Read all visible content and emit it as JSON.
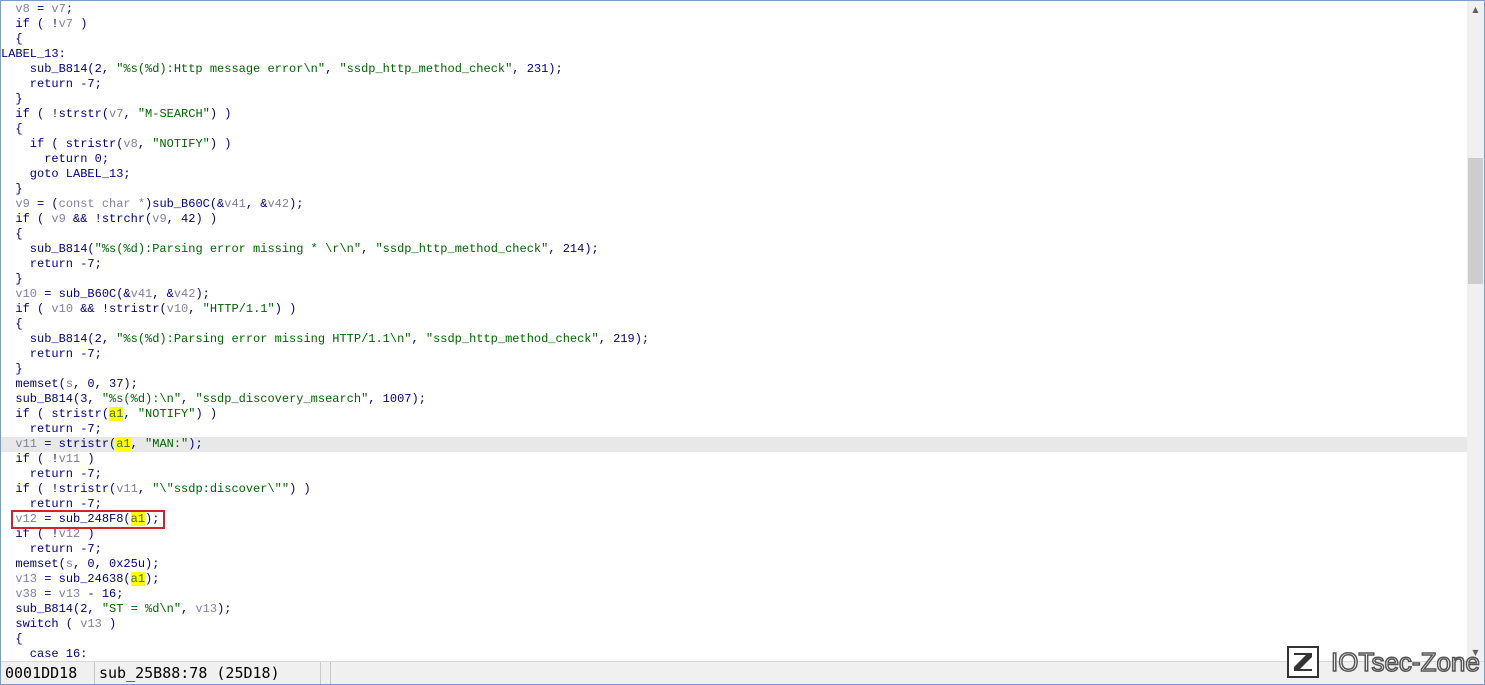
{
  "code_lines": [
    [
      [
        "  ",
        ""
      ],
      [
        "v8",
        "v"
      ],
      [
        " = ",
        ""
      ],
      [
        "v7",
        "v"
      ],
      [
        ";",
        ""
      ]
    ],
    [
      [
        "  if ( !",
        ""
      ],
      [
        "v7",
        "v"
      ],
      [
        " )",
        ""
      ]
    ],
    [
      [
        "  {",
        ""
      ]
    ],
    [
      [
        "LABEL_13:",
        ""
      ]
    ],
    [
      [
        "    sub_B814(2, ",
        ""
      ],
      [
        "\"%s(%d):Http message error\\n\"",
        "s"
      ],
      [
        ", ",
        ""
      ],
      [
        "\"ssdp_http_method_check\"",
        "s"
      ],
      [
        ", 231);",
        ""
      ]
    ],
    [
      [
        "    return -7;",
        ""
      ]
    ],
    [
      [
        "  }",
        ""
      ]
    ],
    [
      [
        "  if ( !strstr(",
        ""
      ],
      [
        "v7",
        "v"
      ],
      [
        ", ",
        ""
      ],
      [
        "\"M-SEARCH\"",
        "s"
      ],
      [
        ") )",
        ""
      ]
    ],
    [
      [
        "  {",
        ""
      ]
    ],
    [
      [
        "    if ( stristr(",
        ""
      ],
      [
        "v8",
        "v"
      ],
      [
        ", ",
        ""
      ],
      [
        "\"NOTIFY\"",
        "s"
      ],
      [
        ") )",
        ""
      ]
    ],
    [
      [
        "      return 0;",
        ""
      ]
    ],
    [
      [
        "    goto LABEL_13;",
        ""
      ]
    ],
    [
      [
        "  }",
        ""
      ]
    ],
    [
      [
        "  ",
        ""
      ],
      [
        "v9",
        "v"
      ],
      [
        " = (",
        ""
      ],
      [
        "const char *",
        "v"
      ],
      [
        ")sub_B60C(&",
        ""
      ],
      [
        "v41",
        "v"
      ],
      [
        ", &",
        ""
      ],
      [
        "v42",
        "v"
      ],
      [
        ");",
        ""
      ]
    ],
    [
      [
        "  if ( ",
        ""
      ],
      [
        "v9",
        "v"
      ],
      [
        " && !strchr(",
        ""
      ],
      [
        "v9",
        "v"
      ],
      [
        ", 42) )",
        ""
      ]
    ],
    [
      [
        "  {",
        ""
      ]
    ],
    [
      [
        "    sub_B814(",
        ""
      ],
      [
        "\"%s(%d):Parsing error missing * \\r\\n\"",
        "s"
      ],
      [
        ", ",
        ""
      ],
      [
        "\"ssdp_http_method_check\"",
        "s"
      ],
      [
        ", 214);",
        ""
      ]
    ],
    [
      [
        "    return -7;",
        ""
      ]
    ],
    [
      [
        "  }",
        ""
      ]
    ],
    [
      [
        "  ",
        ""
      ],
      [
        "v10",
        "v"
      ],
      [
        " = sub_B60C(&",
        ""
      ],
      [
        "v41",
        "v"
      ],
      [
        ", &",
        ""
      ],
      [
        "v42",
        "v"
      ],
      [
        ");",
        ""
      ]
    ],
    [
      [
        "  if ( ",
        ""
      ],
      [
        "v10",
        "v"
      ],
      [
        " && !stristr(",
        ""
      ],
      [
        "v10",
        "v"
      ],
      [
        ", ",
        ""
      ],
      [
        "\"HTTP/1.1\"",
        "s"
      ],
      [
        ") )",
        ""
      ]
    ],
    [
      [
        "  {",
        ""
      ]
    ],
    [
      [
        "    sub_B814(2, ",
        ""
      ],
      [
        "\"%s(%d):Parsing error missing HTTP/1.1\\n\"",
        "s"
      ],
      [
        ", ",
        ""
      ],
      [
        "\"ssdp_http_method_check\"",
        "s"
      ],
      [
        ", 219);",
        ""
      ]
    ],
    [
      [
        "    return -7;",
        ""
      ]
    ],
    [
      [
        "  }",
        ""
      ]
    ],
    [
      [
        "  memset(",
        ""
      ],
      [
        "s",
        "v"
      ],
      [
        ", 0, 37);",
        ""
      ]
    ],
    [
      [
        "  sub_B814(3, ",
        ""
      ],
      [
        "\"%s(%d):\\n\"",
        "s"
      ],
      [
        ", ",
        ""
      ],
      [
        "\"ssdp_discovery_msearch\"",
        "s"
      ],
      [
        ", 1007);",
        ""
      ]
    ],
    [
      [
        "  if ( stristr(",
        ""
      ],
      [
        "a1",
        "hl"
      ],
      [
        ", ",
        ""
      ],
      [
        "\"NOTIFY\"",
        "s"
      ],
      [
        ") )",
        ""
      ]
    ],
    [
      [
        "    return -7;",
        ""
      ]
    ],
    [
      [
        "  ",
        ""
      ],
      [
        "v11",
        "v"
      ],
      [
        " = stristr(",
        ""
      ],
      [
        "|",
        "caret"
      ],
      [
        "a1",
        "hl"
      ],
      [
        ", ",
        ""
      ],
      [
        "\"MAN:\"",
        "s"
      ],
      [
        ");",
        ""
      ]
    ],
    [
      [
        "  if ( !",
        ""
      ],
      [
        "v11",
        "v"
      ],
      [
        " )",
        ""
      ]
    ],
    [
      [
        "    return -7;",
        ""
      ]
    ],
    [
      [
        "  if ( !stristr(",
        ""
      ],
      [
        "v11",
        "v"
      ],
      [
        ", ",
        ""
      ],
      [
        "\"\\\"ssdp:discover\\\"\"",
        "s"
      ],
      [
        ") )",
        ""
      ]
    ],
    [
      [
        "    return -7;",
        ""
      ]
    ],
    [
      [
        "  ",
        ""
      ],
      [
        "v12",
        "v"
      ],
      [
        " = sub_248F8(",
        ""
      ],
      [
        "a1",
        "hl"
      ],
      [
        ");",
        ""
      ]
    ],
    [
      [
        "  if ( !",
        ""
      ],
      [
        "v12",
        "v"
      ],
      [
        " )",
        ""
      ]
    ],
    [
      [
        "    return -7;",
        ""
      ]
    ],
    [
      [
        "  memset(",
        ""
      ],
      [
        "s",
        "v"
      ],
      [
        ", 0, 0x25u);",
        ""
      ]
    ],
    [
      [
        "  ",
        ""
      ],
      [
        "v13",
        "v"
      ],
      [
        " = sub_24638(",
        ""
      ],
      [
        "a1",
        "hl"
      ],
      [
        ");",
        ""
      ]
    ],
    [
      [
        "  ",
        ""
      ],
      [
        "v38",
        "v"
      ],
      [
        " = ",
        ""
      ],
      [
        "v13",
        "v"
      ],
      [
        " - 16;",
        ""
      ]
    ],
    [
      [
        "  sub_B814(2, ",
        ""
      ],
      [
        "\"ST = %d\\n\"",
        "s"
      ],
      [
        ", ",
        ""
      ],
      [
        "v13",
        "v"
      ],
      [
        ");",
        ""
      ]
    ],
    [
      [
        "  switch ( ",
        ""
      ],
      [
        "v13",
        "v"
      ],
      [
        " )",
        ""
      ]
    ],
    [
      [
        "  {",
        ""
      ]
    ],
    [
      [
        "    case 16:",
        ""
      ]
    ]
  ],
  "current_line_index": 29,
  "highlighted_line_index": 34,
  "status": {
    "address": "0001DD18",
    "function": "sub_25B88:78 (25D18)"
  },
  "watermark": {
    "logo_letter": "Z",
    "text": "IOTsec-Zone"
  },
  "colors": {
    "keyword": "#000080",
    "variable": "#8080a0",
    "string": "#006400",
    "highlight": "#ffff00",
    "box": "#d0242b"
  }
}
